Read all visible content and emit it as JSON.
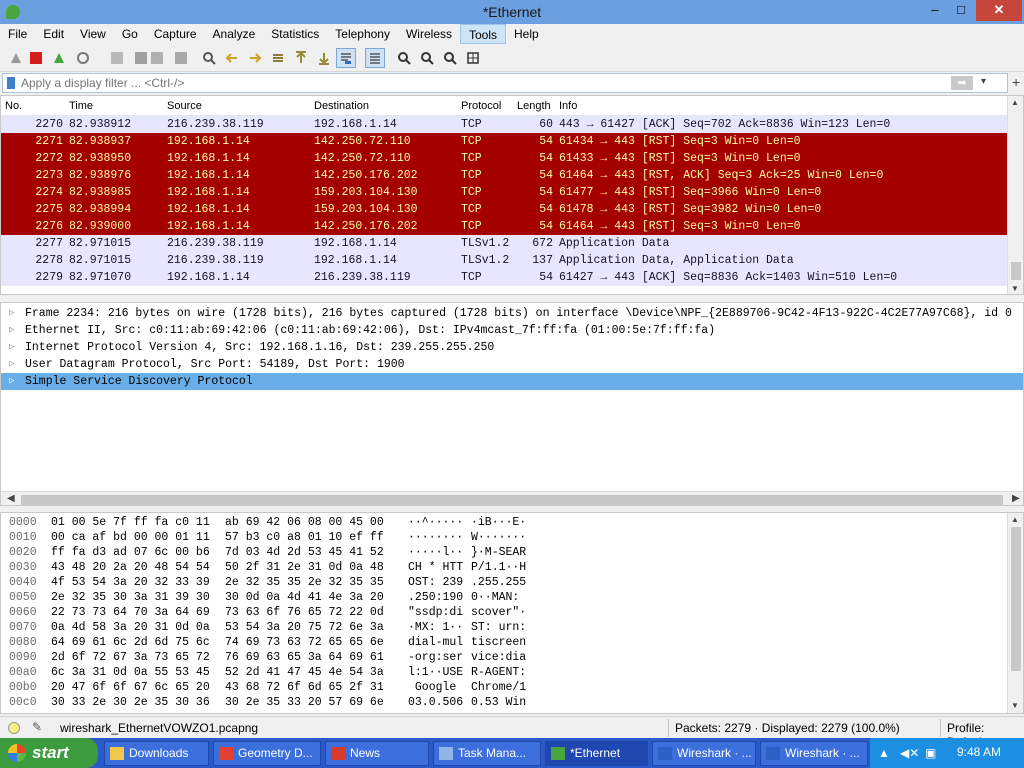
{
  "window": {
    "title": "*Ethernet",
    "minimize": "–",
    "maximize": "□",
    "close": "✕"
  },
  "menu": [
    "File",
    "Edit",
    "View",
    "Go",
    "Capture",
    "Analyze",
    "Statistics",
    "Telephony",
    "Wireless",
    "Tools",
    "Help"
  ],
  "menu_active": "Tools",
  "filter": {
    "placeholder": "Apply a display filter ... <Ctrl-/>",
    "value": "",
    "apply_glyph": "➡",
    "dropdown_glyph": "▾",
    "add_glyph": "+"
  },
  "packet_list": {
    "columns": [
      "No.",
      "Time",
      "Source",
      "Destination",
      "Protocol",
      "Length",
      "Info"
    ],
    "rows": [
      {
        "no": "2270",
        "time": "82.938912",
        "src": "216.239.38.119",
        "dst": "192.168.1.14",
        "proto": "TCP",
        "len": "60",
        "info": "443 → 61427 [ACK] Seq=702 Ack=8836 Win=123 Len=0",
        "style": "light"
      },
      {
        "no": "2271",
        "time": "82.938937",
        "src": "192.168.1.14",
        "dst": "142.250.72.110",
        "proto": "TCP",
        "len": "54",
        "info": "61434 → 443 [RST] Seq=3 Win=0 Len=0",
        "style": "red"
      },
      {
        "no": "2272",
        "time": "82.938950",
        "src": "192.168.1.14",
        "dst": "142.250.72.110",
        "proto": "TCP",
        "len": "54",
        "info": "61433 → 443 [RST] Seq=3 Win=0 Len=0",
        "style": "red"
      },
      {
        "no": "2273",
        "time": "82.938976",
        "src": "192.168.1.14",
        "dst": "142.250.176.202",
        "proto": "TCP",
        "len": "54",
        "info": "61464 → 443 [RST, ACK] Seq=3 Ack=25 Win=0 Len=0",
        "style": "red"
      },
      {
        "no": "2274",
        "time": "82.938985",
        "src": "192.168.1.14",
        "dst": "159.203.104.130",
        "proto": "TCP",
        "len": "54",
        "info": "61477 → 443 [RST] Seq=3966 Win=0 Len=0",
        "style": "red"
      },
      {
        "no": "2275",
        "time": "82.938994",
        "src": "192.168.1.14",
        "dst": "159.203.104.130",
        "proto": "TCP",
        "len": "54",
        "info": "61478 → 443 [RST] Seq=3982 Win=0 Len=0",
        "style": "red"
      },
      {
        "no": "2276",
        "time": "82.939000",
        "src": "192.168.1.14",
        "dst": "142.250.176.202",
        "proto": "TCP",
        "len": "54",
        "info": "61464 → 443 [RST] Seq=3 Win=0 Len=0",
        "style": "red"
      },
      {
        "no": "2277",
        "time": "82.971015",
        "src": "216.239.38.119",
        "dst": "192.168.1.14",
        "proto": "TLSv1.2",
        "len": "672",
        "info": "Application Data",
        "style": "light"
      },
      {
        "no": "2278",
        "time": "82.971015",
        "src": "216.239.38.119",
        "dst": "192.168.1.14",
        "proto": "TLSv1.2",
        "len": "137",
        "info": "Application Data, Application Data",
        "style": "light"
      },
      {
        "no": "2279",
        "time": "82.971070",
        "src": "192.168.1.14",
        "dst": "216.239.38.119",
        "proto": "TCP",
        "len": "54",
        "info": "61427 → 443 [ACK] Seq=8836 Ack=1403 Win=510 Len=0",
        "style": "light"
      }
    ]
  },
  "details": [
    {
      "text": "Frame 2234: 216 bytes on wire (1728 bits), 216 bytes captured (1728 bits) on interface \\Device\\NPF_{2E889706-9C42-4F13-922C-4C2E77A97C68}, id 0",
      "selected": false
    },
    {
      "text": "Ethernet II, Src: c0:11:ab:69:42:06 (c0:11:ab:69:42:06), Dst: IPv4mcast_7f:ff:fa (01:00:5e:7f:ff:fa)",
      "selected": false
    },
    {
      "text": "Internet Protocol Version 4, Src: 192.168.1.16, Dst: 239.255.255.250",
      "selected": false
    },
    {
      "text": "User Datagram Protocol, Src Port: 54189, Dst Port: 1900",
      "selected": false
    },
    {
      "text": "Simple Service Discovery Protocol",
      "selected": true
    }
  ],
  "bytes": [
    {
      "off": "0000",
      "h1": "01 00 5e 7f ff fa c0 11",
      "h2": "ab 69 42 06 08 00 45 00",
      "a1": "··^·····",
      "a2": "·iB···E·"
    },
    {
      "off": "0010",
      "h1": "00 ca af bd 00 00 01 11",
      "h2": "57 b3 c0 a8 01 10 ef ff",
      "a1": "········",
      "a2": "W·······"
    },
    {
      "off": "0020",
      "h1": "ff fa d3 ad 07 6c 00 b6",
      "h2": "7d 03 4d 2d 53 45 41 52",
      "a1": "·····l··",
      "a2": "}·M-SEAR"
    },
    {
      "off": "0030",
      "h1": "43 48 20 2a 20 48 54 54",
      "h2": "50 2f 31 2e 31 0d 0a 48",
      "a1": "CH * HTT",
      "a2": "P/1.1··H"
    },
    {
      "off": "0040",
      "h1": "4f 53 54 3a 20 32 33 39",
      "h2": "2e 32 35 35 2e 32 35 35",
      "a1": "OST: 239",
      "a2": ".255.255"
    },
    {
      "off": "0050",
      "h1": "2e 32 35 30 3a 31 39 30",
      "h2": "30 0d 0a 4d 41 4e 3a 20",
      "a1": ".250:190",
      "a2": "0··MAN: "
    },
    {
      "off": "0060",
      "h1": "22 73 73 64 70 3a 64 69",
      "h2": "73 63 6f 76 65 72 22 0d",
      "a1": "\"ssdp:di",
      "a2": "scover\"·"
    },
    {
      "off": "0070",
      "h1": "0a 4d 58 3a 20 31 0d 0a",
      "h2": "53 54 3a 20 75 72 6e 3a",
      "a1": "·MX: 1··",
      "a2": "ST: urn:"
    },
    {
      "off": "0080",
      "h1": "64 69 61 6c 2d 6d 75 6c",
      "h2": "74 69 73 63 72 65 65 6e",
      "a1": "dial-mul",
      "a2": "tiscreen"
    },
    {
      "off": "0090",
      "h1": "2d 6f 72 67 3a 73 65 72",
      "h2": "76 69 63 65 3a 64 69 61",
      "a1": "-org:ser",
      "a2": "vice:dia"
    },
    {
      "off": "00a0",
      "h1": "6c 3a 31 0d 0a 55 53 45",
      "h2": "52 2d 41 47 45 4e 54 3a",
      "a1": "l:1··USE",
      "a2": "R-AGENT:"
    },
    {
      "off": "00b0",
      "h1": "20 47 6f 6f 67 6c 65 20",
      "h2": "43 68 72 6f 6d 65 2f 31",
      "a1": " Google ",
      "a2": "Chrome/1"
    },
    {
      "off": "00c0",
      "h1": "30 33 2e 30 2e 35 30 36",
      "h2": "30 2e 35 33 20 57 69 6e",
      "a1": "03.0.506",
      "a2": "0.53 Win"
    }
  ],
  "status": {
    "file": "wireshark_EthernetVOWZO1.pcapng",
    "packets": "Packets: 2279 · Displayed: 2279 (100.0%)",
    "profile": "Profile: Default"
  },
  "taskbar": {
    "start": "start",
    "tasks": [
      {
        "label": "Downloads",
        "active": false
      },
      {
        "label": "Geometry D...",
        "active": false
      },
      {
        "label": "News",
        "active": false
      },
      {
        "label": "Task Mana...",
        "active": false
      },
      {
        "label": "*Ethernet",
        "active": true
      },
      {
        "label": "Wireshark · ...",
        "active": false
      },
      {
        "label": "Wireshark · ...",
        "active": false
      }
    ],
    "clock": "9:48 AM"
  },
  "colors": {
    "red_row_bg": "#a40000",
    "red_row_fg": "#fffc9c",
    "light_row_bg": "#e7e6ff",
    "selected_detail": "#6aaee8",
    "titlebar": "#6b9fe0",
    "taskbar": "#2a59c9"
  }
}
